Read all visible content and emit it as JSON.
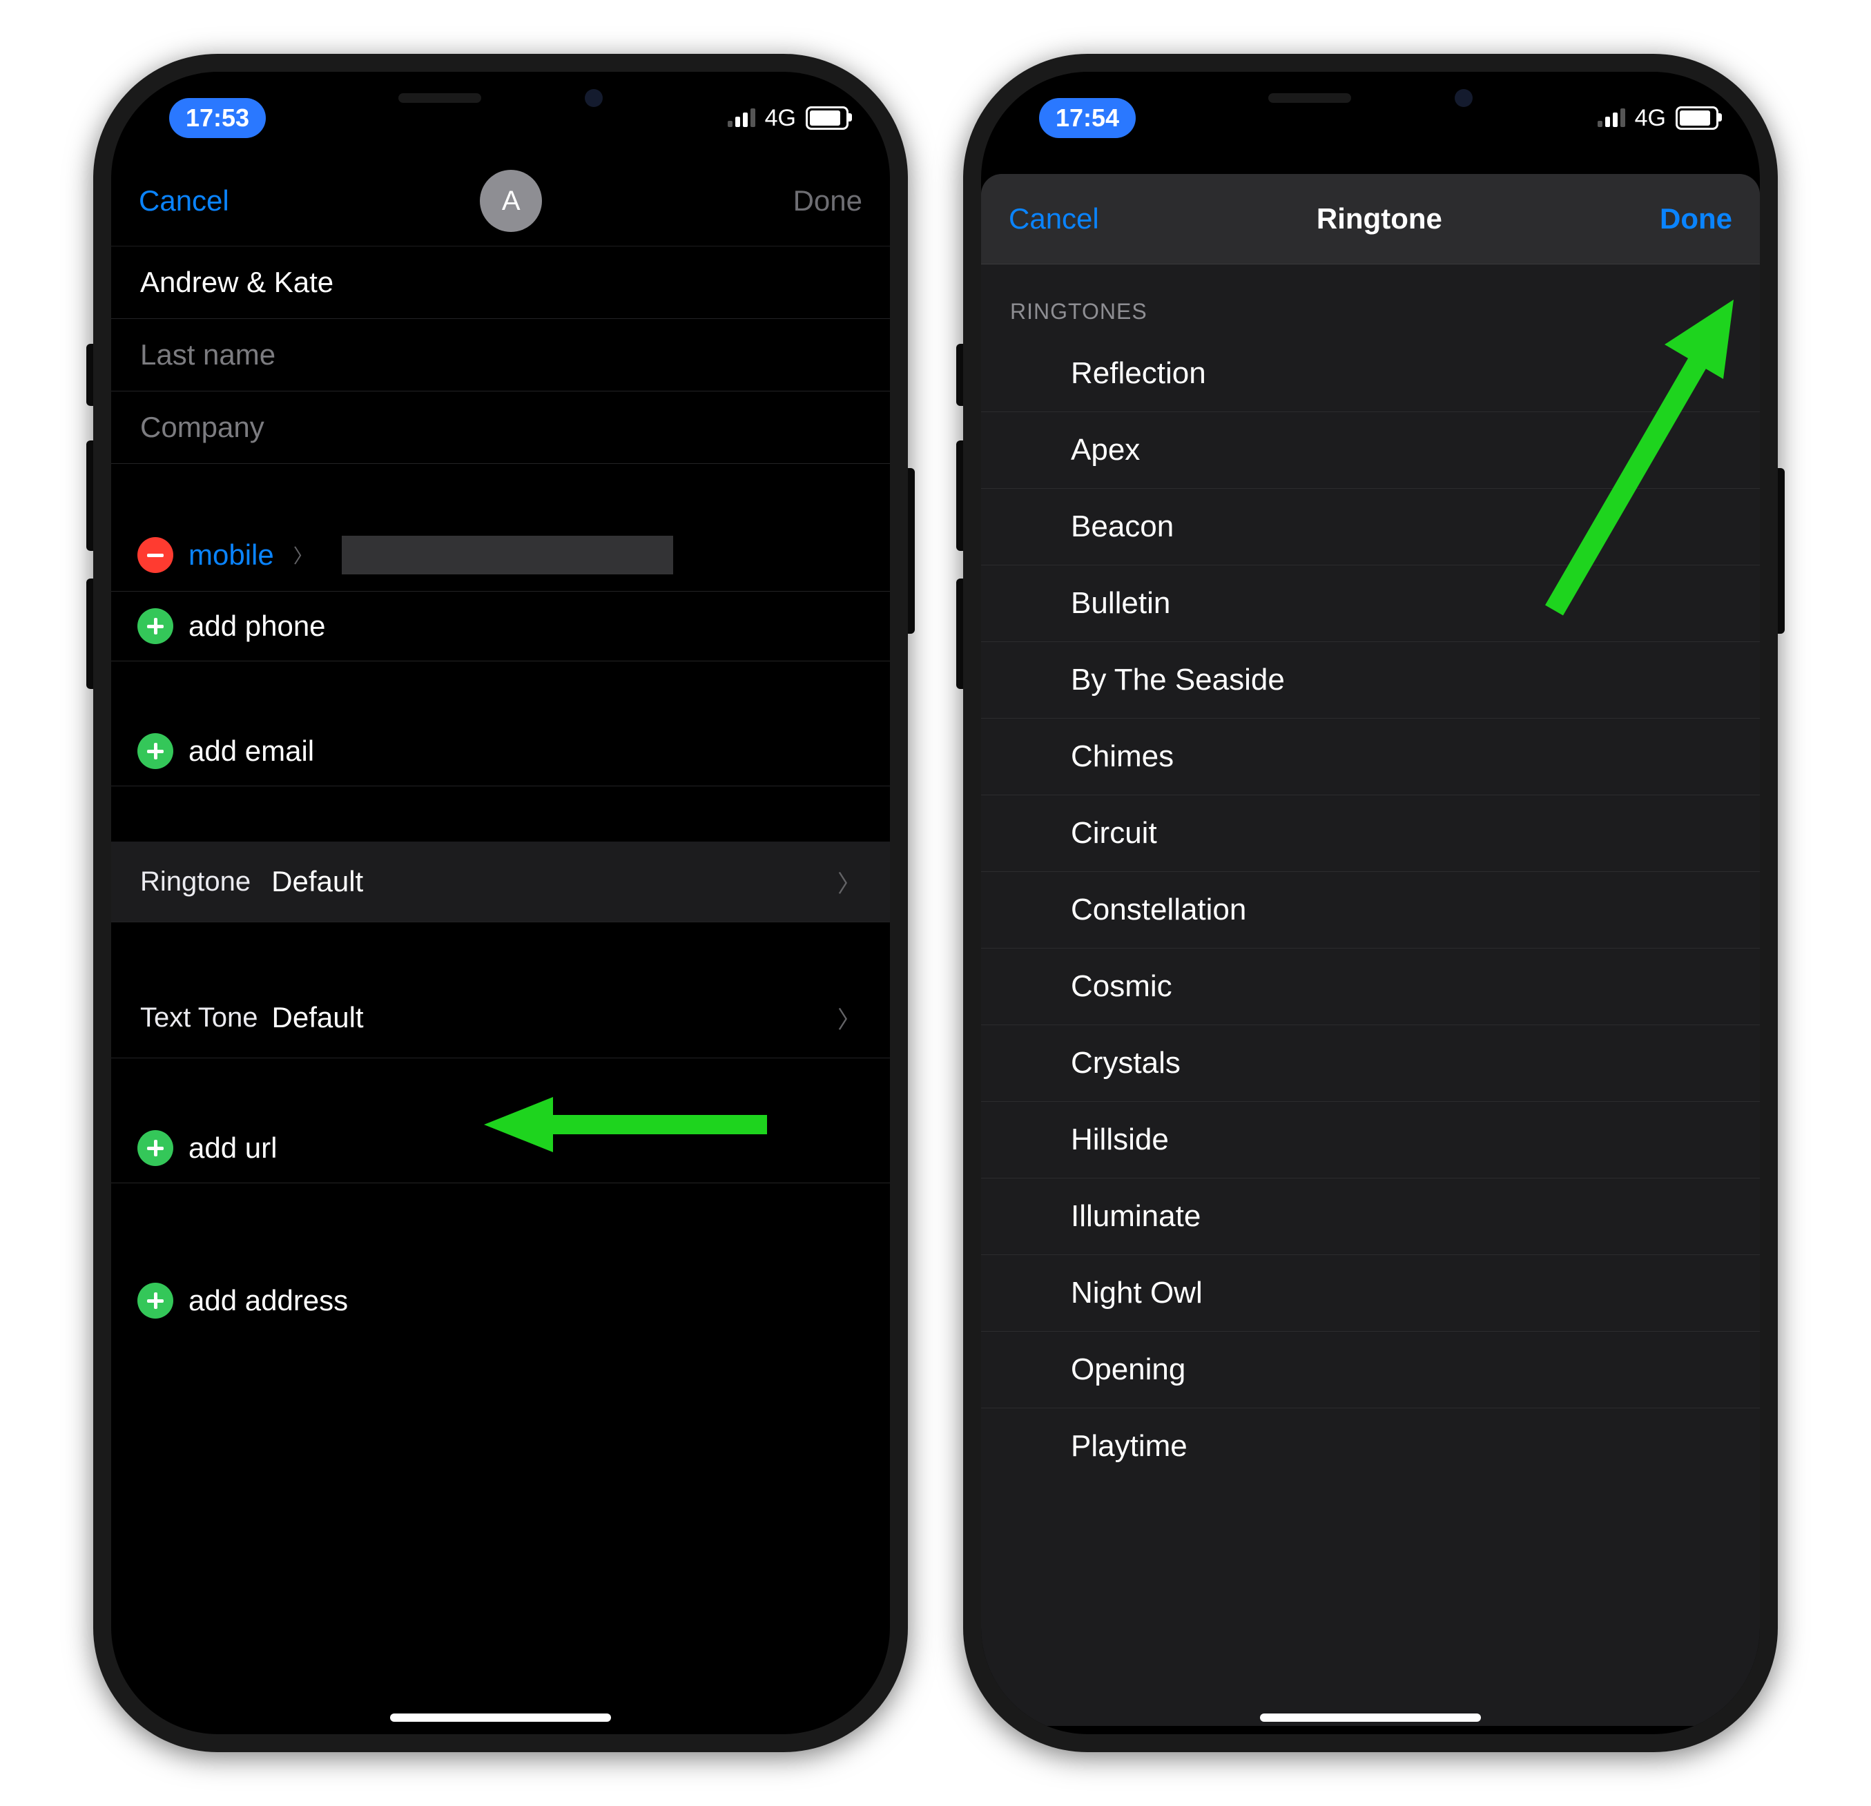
{
  "left": {
    "status": {
      "time": "17:53",
      "network": "4G"
    },
    "nav": {
      "cancel": "Cancel",
      "done": "Done",
      "avatar_letter": "A"
    },
    "fields": {
      "first": "Andrew & Kate",
      "last_placeholder": "Last name",
      "company_placeholder": "Company"
    },
    "phone": {
      "type_label": "mobile",
      "add_phone": "add phone"
    },
    "email": {
      "add_email": "add email"
    },
    "ringtone": {
      "label": "Ringtone",
      "value": "Default"
    },
    "texttone": {
      "label": "Text Tone",
      "value": "Default"
    },
    "url": {
      "add_url": "add url"
    },
    "address": {
      "add_address": "add address"
    }
  },
  "right": {
    "status": {
      "time": "17:54",
      "network": "4G"
    },
    "nav": {
      "cancel": "Cancel",
      "title": "Ringtone",
      "done": "Done"
    },
    "section_header": "RINGTONES",
    "ringtones": [
      "Reflection",
      "Apex",
      "Beacon",
      "Bulletin",
      "By The Seaside",
      "Chimes",
      "Circuit",
      "Constellation",
      "Cosmic",
      "Crystals",
      "Hillside",
      "Illuminate",
      "Night Owl",
      "Opening",
      "Playtime"
    ]
  }
}
